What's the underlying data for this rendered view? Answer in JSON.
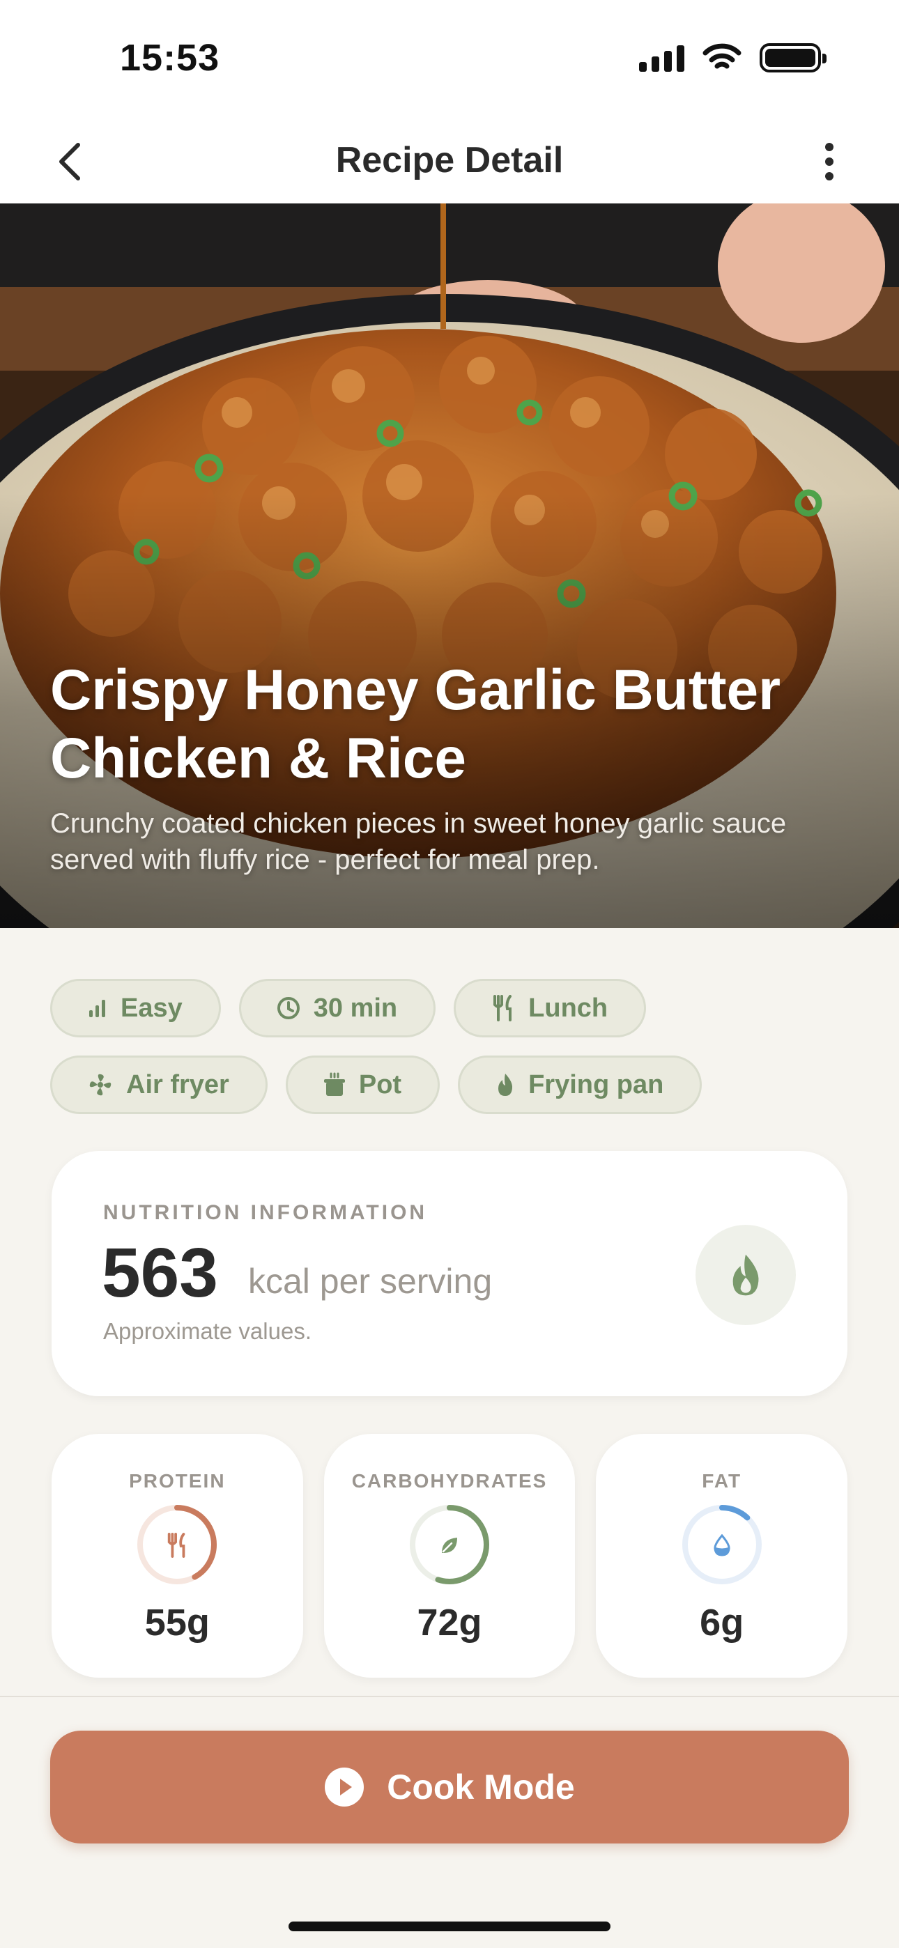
{
  "status_bar": {
    "time": "15:53",
    "icons": [
      "signal-icon",
      "wifi-icon",
      "battery-icon"
    ]
  },
  "nav": {
    "title": "Recipe Detail",
    "back_icon": "chevron-left-icon",
    "more_icon": "more-vertical-icon"
  },
  "hero": {
    "title": "Crispy Honey Garlic Butter Chicken & Rice",
    "subtitle": "Crunchy coated chicken pieces in sweet honey garlic sauce served with fluffy rice - perfect for meal prep."
  },
  "tags": [
    {
      "label": "Easy",
      "icon": "difficulty-bars-icon"
    },
    {
      "label": "30 min",
      "icon": "clock-icon"
    },
    {
      "label": "Lunch",
      "icon": "utensils-icon"
    },
    {
      "label": "Air fryer",
      "icon": "fan-icon"
    },
    {
      "label": "Pot",
      "icon": "pot-icon"
    },
    {
      "label": "Frying pan",
      "icon": "flame-icon"
    }
  ],
  "nutrition": {
    "heading": "NUTRITION INFORMATION",
    "kcal": "563",
    "kcal_unit": "kcal per serving",
    "note": "Approximate values."
  },
  "macros": [
    {
      "label": "PROTEIN",
      "value": "55g",
      "icon": "utensils-icon",
      "color": "#c97b5e",
      "progress": 0.42
    },
    {
      "label": "CARBOHYDRATES",
      "value": "72g",
      "icon": "leaf-icon",
      "color": "#7a9a6c",
      "progress": 0.55
    },
    {
      "label": "FAT",
      "value": "6g",
      "icon": "droplet-icon",
      "color": "#5d9bd9",
      "progress": 0.12
    }
  ],
  "cook_button": {
    "label": "Cook Mode",
    "icon": "play-circle-icon"
  },
  "colors": {
    "accent": "#c97b5e",
    "tag_text": "#6e8a62",
    "tag_bg": "#eaeade",
    "background": "#f6f4ef"
  }
}
